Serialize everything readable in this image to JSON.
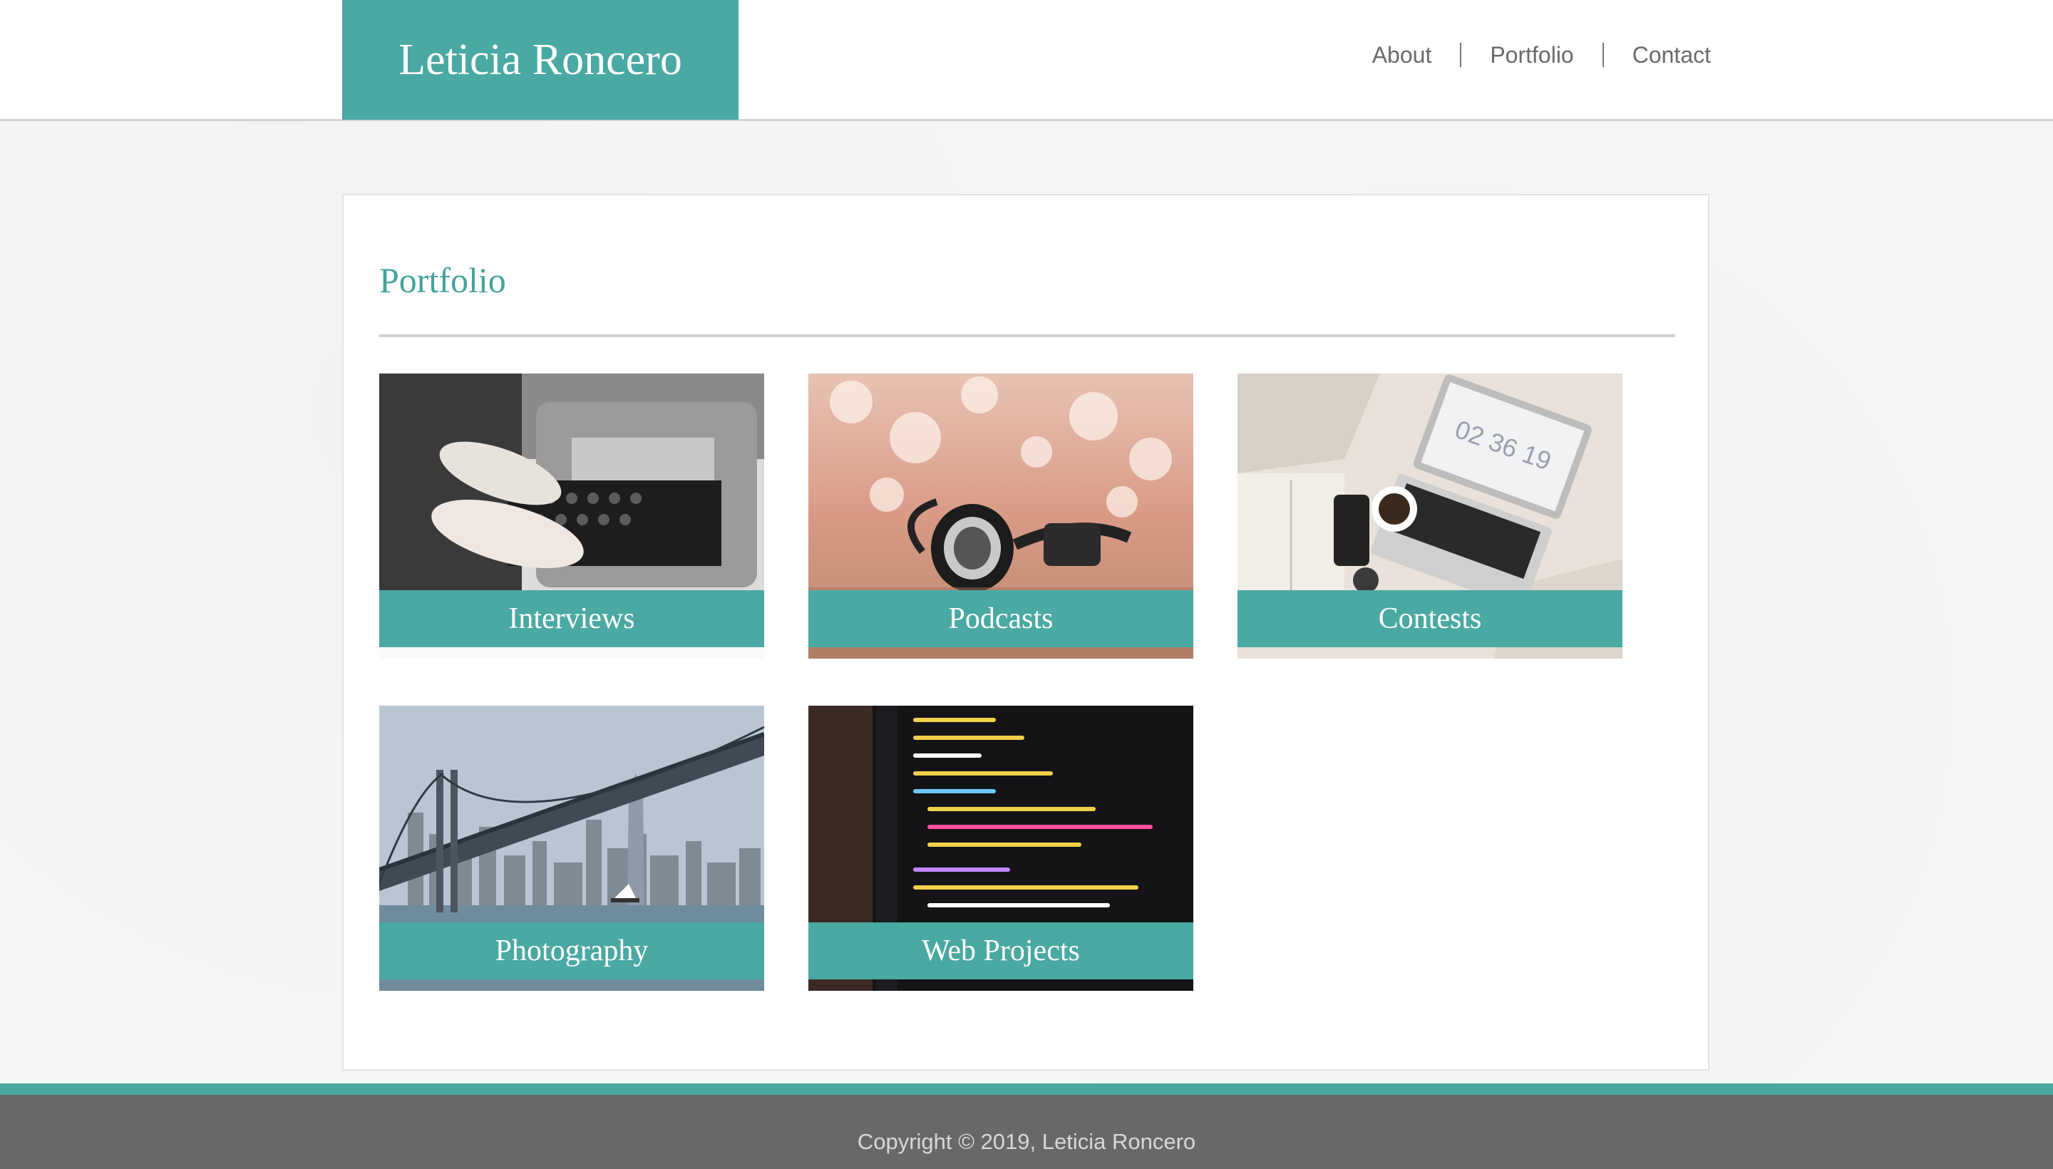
{
  "header": {
    "site_title": "Leticia Roncero",
    "nav": [
      "About",
      "Portfolio",
      "Contact"
    ]
  },
  "main": {
    "heading": "Portfolio",
    "tiles": [
      {
        "label": "Interviews",
        "image": "typewriter-photo"
      },
      {
        "label": "Podcasts",
        "image": "headphones-photo"
      },
      {
        "label": "Contests",
        "image": "laptop-bed-photo"
      },
      {
        "label": "Photography",
        "image": "bay-bridge-city-photo"
      },
      {
        "label": "Web Projects",
        "image": "code-screen-photo"
      }
    ]
  },
  "footer": {
    "copyright": "Copyright © 2019, Leticia Roncero"
  },
  "colors": {
    "accent": "#4aa9a2",
    "heading": "#43a39c",
    "footer_bg": "#686868",
    "nav_text": "#6a6a6a"
  }
}
